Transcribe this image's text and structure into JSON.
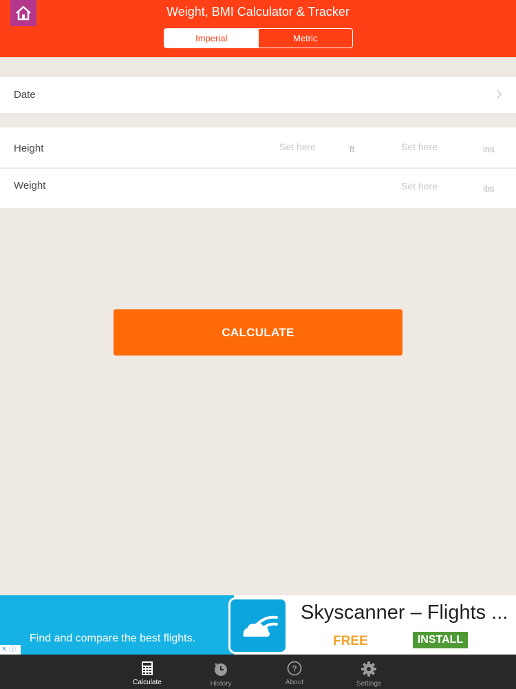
{
  "header": {
    "title": "Weight, BMI Calculator & Tracker",
    "unit_tabs": [
      "Imperial",
      "Metric"
    ],
    "active_unit": "Imperial",
    "color": "#ff4016"
  },
  "date_row": {
    "label": "Date"
  },
  "height_row": {
    "label": "Height",
    "feet_placeholder": "Set here",
    "feet_unit": "ft",
    "inches_placeholder": "Set here",
    "inches_unit": "ins"
  },
  "weight_row": {
    "label": "Weight",
    "placeholder": "Set here",
    "unit": "ibs"
  },
  "calculate_label": "CALCULATE",
  "ad": {
    "tagline": "Find and compare the best flights.",
    "app_name": "Skyscanner – Flights ...",
    "price": "FREE",
    "install_label": "INSTALL"
  },
  "tabbar": {
    "tabs": [
      {
        "label": "Calculate",
        "icon": "calculator-icon",
        "active": true
      },
      {
        "label": "History",
        "icon": "history-icon"
      },
      {
        "label": "About",
        "icon": "question-icon"
      },
      {
        "label": "Settings",
        "icon": "gear-icon"
      }
    ]
  }
}
